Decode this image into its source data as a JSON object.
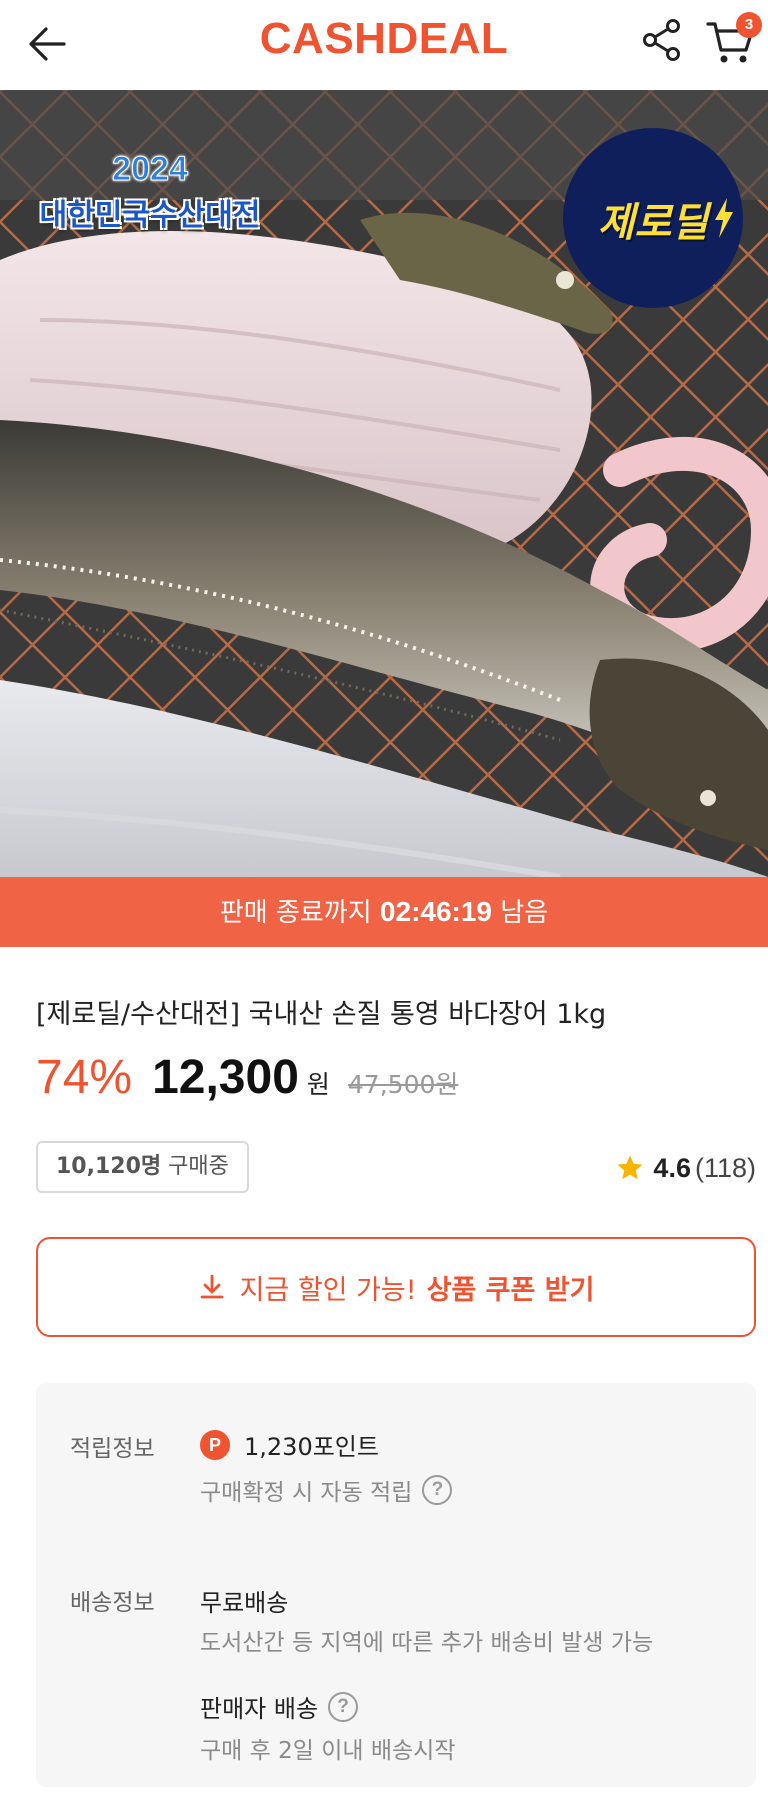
{
  "header": {
    "logo": "CASHDEAL",
    "cart_count": "3",
    "icons": {
      "back": "arrow-left-icon",
      "share": "share-icon",
      "cart": "cart-icon"
    }
  },
  "product_image": {
    "festival_badge": {
      "year": "2024",
      "title": "대한민국수산대전"
    },
    "zero_deal_badge": "제로딜"
  },
  "timer": {
    "prefix": "판매 종료까지",
    "time": "02:46:19",
    "suffix": "남음"
  },
  "product": {
    "title": "[제로딜/수산대전] 국내산 손질 통영 바다장어 1kg",
    "discount": "74%",
    "price": "12,300",
    "price_unit": "원",
    "original_price": "47,500원",
    "buyers_count": "10,120명",
    "buyers_suffix": "구매중",
    "rating": "4.6",
    "review_count": "(118)"
  },
  "coupon": {
    "text": "지금 할인 가능!",
    "strong": "상품 쿠폰 받기"
  },
  "info": {
    "points_label": "적립정보",
    "points_icon": "P",
    "points_value": "1,230포인트",
    "points_note": "구매확정 시 자동 적립",
    "shipping_label": "배송정보",
    "shipping_value": "무료배송",
    "shipping_note": "도서산간 등 지역에 따른 추가 배송비 발생 가능",
    "seller_shipping": "판매자 배송",
    "seller_note": "구매 후 2일 이내 배송시작",
    "help_mark": "?"
  },
  "colors": {
    "brand": "#f0532f",
    "timer_bg": "#f06445",
    "panel_bg": "#f6f6f6"
  }
}
